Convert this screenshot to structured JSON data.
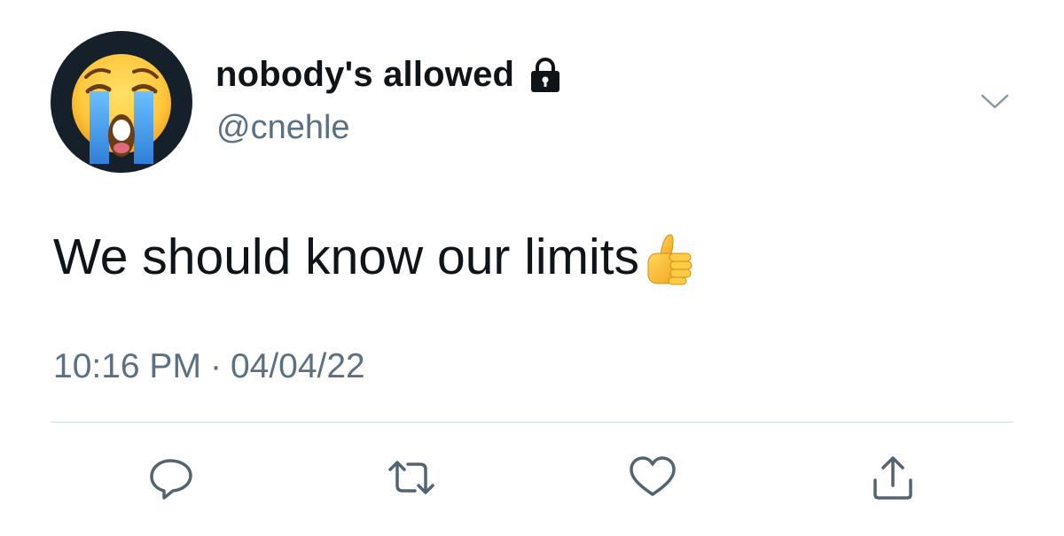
{
  "tweet": {
    "author": {
      "display_name": "nobody's allowed",
      "handle": "@cnehle",
      "protected": true,
      "avatar_icon": "loudly-crying-face-emoji"
    },
    "text": "We should know our limits",
    "text_emoji": "thumbs-up-emoji",
    "time": "10:16 PM",
    "separator": "·",
    "date": "04/04/22",
    "actions": [
      {
        "name": "reply",
        "icon": "reply-bubble-icon"
      },
      {
        "name": "retweet",
        "icon": "retweet-icon"
      },
      {
        "name": "like",
        "icon": "heart-icon"
      },
      {
        "name": "share",
        "icon": "share-upload-icon"
      }
    ]
  },
  "colors": {
    "primary_text": "#0f1419",
    "secondary_text": "#5b7083",
    "icon_gray": "#536471",
    "divider": "#cfd9de",
    "avatar_bg": "#16202b"
  }
}
